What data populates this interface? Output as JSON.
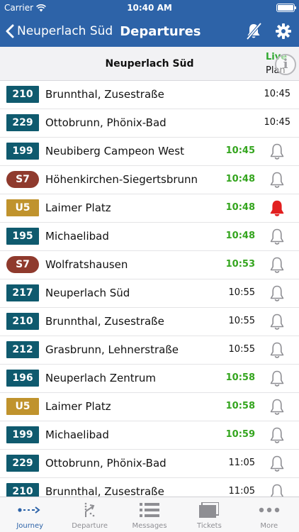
{
  "status_bar": {
    "carrier": "Carrier",
    "time": "10:40 AM"
  },
  "nav": {
    "back_label": "Neuperlach Süd",
    "title": "Departures"
  },
  "station": {
    "name": "Neuperlach Süd",
    "live_label": "Live",
    "plan_label": "Plan",
    "info_glyph": "i"
  },
  "colors": {
    "accent": "#2d63a8",
    "bus": "#0f5a6e",
    "sbahn": "#8f3a2d",
    "ubahn": "#c0932d",
    "live_time": "#34a51e",
    "alarm_active": "#e21f1f"
  },
  "departures": [
    {
      "line": "210",
      "kind": "bus",
      "destination": "Brunnthal, Zusestraße",
      "time": "10:45",
      "live": false,
      "bell": "none"
    },
    {
      "line": "229",
      "kind": "bus",
      "destination": "Ottobrunn, Phönix-Bad",
      "time": "10:45",
      "live": false,
      "bell": "none"
    },
    {
      "line": "199",
      "kind": "bus",
      "destination": "Neubiberg Campeon West",
      "time": "10:45",
      "live": true,
      "bell": "off"
    },
    {
      "line": "S7",
      "kind": "sbahn",
      "destination": "Höhenkirchen-Siegertsbrunn",
      "time": "10:48",
      "live": true,
      "bell": "off"
    },
    {
      "line": "U5",
      "kind": "ubahn",
      "destination": "Laimer Platz",
      "time": "10:48",
      "live": true,
      "bell": "on"
    },
    {
      "line": "195",
      "kind": "bus",
      "destination": "Michaelibad",
      "time": "10:48",
      "live": true,
      "bell": "off"
    },
    {
      "line": "S7",
      "kind": "sbahn",
      "destination": "Wolfratshausen",
      "time": "10:53",
      "live": true,
      "bell": "off"
    },
    {
      "line": "217",
      "kind": "bus",
      "destination": "Neuperlach Süd",
      "time": "10:55",
      "live": false,
      "bell": "off"
    },
    {
      "line": "210",
      "kind": "bus",
      "destination": "Brunnthal, Zusestraße",
      "time": "10:55",
      "live": false,
      "bell": "off"
    },
    {
      "line": "212",
      "kind": "bus",
      "destination": "Grasbrunn, Lehnerstraße",
      "time": "10:55",
      "live": false,
      "bell": "off"
    },
    {
      "line": "196",
      "kind": "bus",
      "destination": "Neuperlach Zentrum",
      "time": "10:58",
      "live": true,
      "bell": "off"
    },
    {
      "line": "U5",
      "kind": "ubahn",
      "destination": "Laimer Platz",
      "time": "10:58",
      "live": true,
      "bell": "off"
    },
    {
      "line": "199",
      "kind": "bus",
      "destination": "Michaelibad",
      "time": "10:59",
      "live": true,
      "bell": "off"
    },
    {
      "line": "229",
      "kind": "bus",
      "destination": "Ottobrunn, Phönix-Bad",
      "time": "11:05",
      "live": false,
      "bell": "off"
    },
    {
      "line": "210",
      "kind": "bus",
      "destination": "Brunnthal, Zusestraße",
      "time": "11:05",
      "live": false,
      "bell": "off"
    }
  ],
  "tabs": [
    {
      "id": "journey",
      "label": "Journey",
      "icon": "journey-icon",
      "active": true
    },
    {
      "id": "departure",
      "label": "Departure",
      "icon": "departure-icon",
      "active": false
    },
    {
      "id": "messages",
      "label": "Messages",
      "icon": "messages-icon",
      "active": false
    },
    {
      "id": "tickets",
      "label": "Tickets",
      "icon": "tickets-icon",
      "active": false
    },
    {
      "id": "more",
      "label": "More",
      "icon": "more-icon",
      "active": false
    }
  ]
}
